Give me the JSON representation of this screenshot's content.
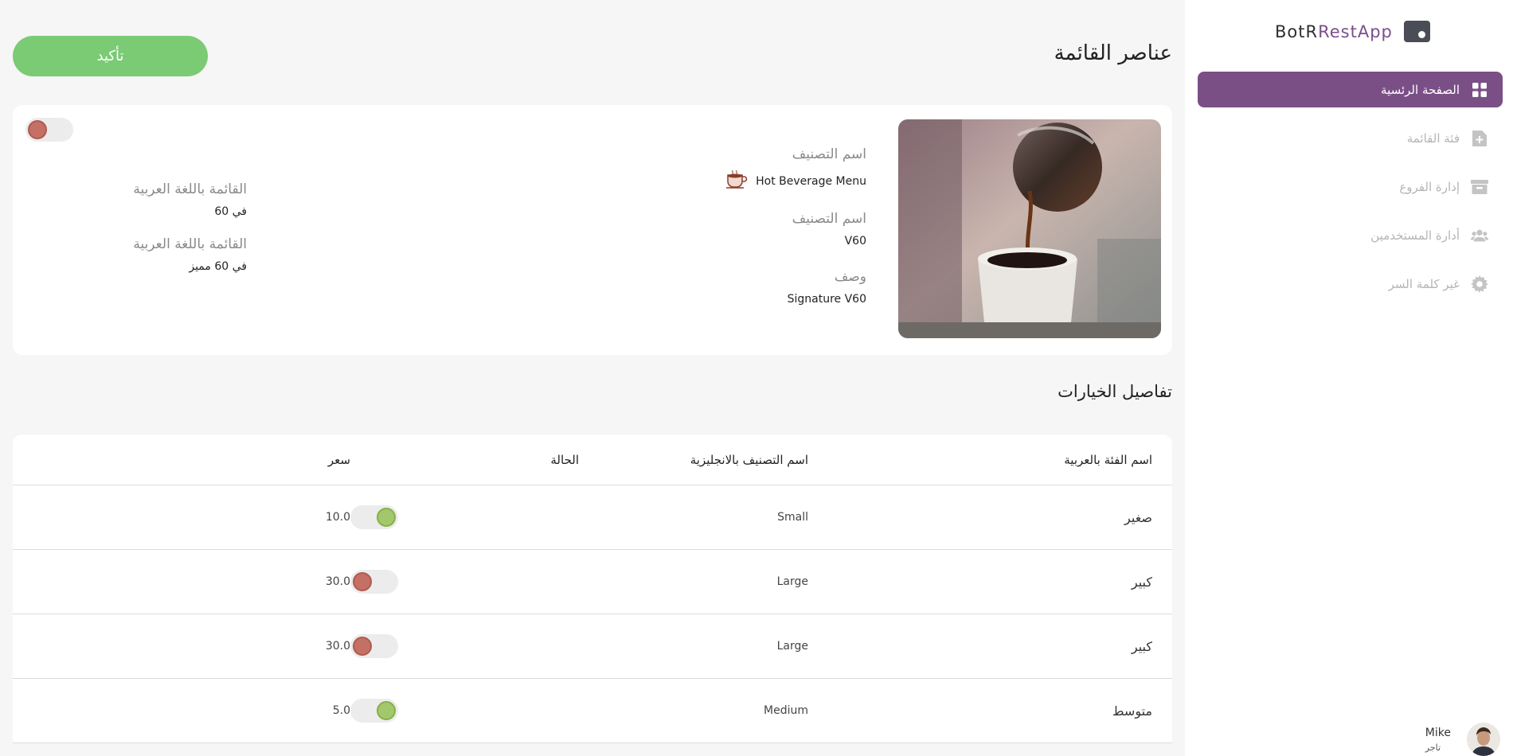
{
  "app": {
    "logo_prefix": "BotR",
    "logo_accent": "RestApp"
  },
  "sidebar": {
    "items": [
      {
        "label": "الصفحة الرئسية",
        "icon": "dashboard-grid-icon",
        "active": true
      },
      {
        "label": "فئة القائمة",
        "icon": "add-file-icon",
        "active": false
      },
      {
        "label": "إدارة الفروع",
        "icon": "archive-box-icon",
        "active": false
      },
      {
        "label": "أدارة المستخدمين",
        "icon": "users-group-icon",
        "active": false
      },
      {
        "label": "غير كلمة السر",
        "icon": "gear-icon",
        "active": false
      }
    ]
  },
  "user": {
    "name": "Mike",
    "role": "تاجر"
  },
  "page": {
    "title": "عناصر القائمة",
    "confirm_label": "تأكيد"
  },
  "item": {
    "category_label": "اسم التصنيف",
    "category_value": "Hot Beverage Menu",
    "name_label": "اسم التصنيف",
    "name_value": "V60",
    "description_label": "وصف",
    "description_value": "Signature V60",
    "arabic_name_label": "القائمة باللغة العربية",
    "arabic_name_value": "في 60",
    "arabic_description_label": "القائمة باللغة العربية",
    "arabic_description_value": "في 60 مميز",
    "status_on": false,
    "image_alt": "coffee-pour-over-photo"
  },
  "options": {
    "title": "تفاصيل الخيارات",
    "columns": [
      "اسم الفئة بالعربية",
      "اسم التصنيف بالانجليزية",
      "الحالة",
      "سعر"
    ],
    "rows": [
      {
        "arabic": "صغير",
        "english": "Small",
        "status_on": true,
        "price": "10.0"
      },
      {
        "arabic": "كبير",
        "english": "Large",
        "status_on": false,
        "price": "30.0"
      },
      {
        "arabic": "كبير",
        "english": "Large",
        "status_on": false,
        "price": "30.0"
      },
      {
        "arabic": "متوسط",
        "english": "Medium",
        "status_on": true,
        "price": "5.0"
      }
    ]
  },
  "colors": {
    "accent": "#7a4f86",
    "confirm": "#7acb74",
    "toggle_on": "#a3c86c",
    "toggle_off": "#c47064"
  }
}
